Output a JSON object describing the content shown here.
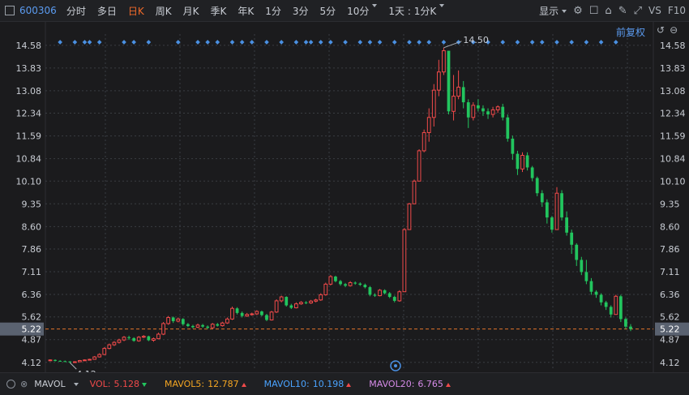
{
  "toolbar": {
    "code": "600306",
    "tabs": [
      {
        "label": "分时",
        "active": false,
        "dropdown": false
      },
      {
        "label": "多日",
        "active": false,
        "dropdown": false
      },
      {
        "label": "日K",
        "active": true,
        "dropdown": false
      },
      {
        "label": "周K",
        "active": false,
        "dropdown": false
      },
      {
        "label": "月K",
        "active": false,
        "dropdown": false
      },
      {
        "label": "季K",
        "active": false,
        "dropdown": false
      },
      {
        "label": "年K",
        "active": false,
        "dropdown": false
      },
      {
        "label": "1分",
        "active": false,
        "dropdown": false
      },
      {
        "label": "3分",
        "active": false,
        "dropdown": false
      },
      {
        "label": "5分",
        "active": false,
        "dropdown": false
      },
      {
        "label": "10分",
        "active": false,
        "dropdown": true
      },
      {
        "label": "1天 : 1分K",
        "active": false,
        "dropdown": true
      }
    ],
    "display_label": "显示",
    "vs_label": "VS",
    "f10_label": "F10",
    "icons": [
      "gear-icon",
      "square-icon",
      "camera-icon",
      "pen-icon",
      "expand-icon"
    ]
  },
  "fuquan": {
    "label": "前复权"
  },
  "axis": {
    "ticks": [
      "14.58",
      "13.83",
      "13.08",
      "12.34",
      "11.59",
      "10.84",
      "10.10",
      "9.35",
      "8.60",
      "7.86",
      "7.11",
      "6.36",
      "5.62",
      "4.87",
      "4.12"
    ],
    "current_price": "5.22"
  },
  "annotations": {
    "high": "14.50",
    "low": "4.12"
  },
  "bottom": {
    "indicator": "MAVOL",
    "vol": {
      "label": "VOL:",
      "value": "5.128",
      "dir": "down"
    },
    "mavol5": {
      "label": "MAVOL5:",
      "value": "12.787",
      "dir": "up"
    },
    "mavol10": {
      "label": "MAVOL10:",
      "value": "10.198",
      "dir": "up"
    },
    "mavol20": {
      "label": "MAVOL20:",
      "value": "6.765",
      "dir": "up"
    }
  },
  "chart_data": {
    "type": "candlestick",
    "y_range": [
      3.9,
      14.95
    ],
    "colors": {
      "up": "#f04a4a",
      "down": "#22c55e",
      "grid": "#3a3d42",
      "label": "#c9cdd4",
      "marker": "#4a90e2",
      "mavol5": "#f5a623",
      "mavol10": "#4aa3ff",
      "mavol20": "#d68be8"
    },
    "candles": [
      [
        4.18,
        4.2,
        4.22,
        4.16
      ],
      [
        4.2,
        4.17,
        4.22,
        4.15
      ],
      [
        4.17,
        4.16,
        4.19,
        4.14
      ],
      [
        4.16,
        4.15,
        4.18,
        4.13
      ],
      [
        4.15,
        4.12,
        4.16,
        4.11
      ],
      [
        4.12,
        4.14,
        4.16,
        4.11
      ],
      [
        4.14,
        4.18,
        4.2,
        4.13
      ],
      [
        4.18,
        4.2,
        4.22,
        4.17
      ],
      [
        4.2,
        4.22,
        4.24,
        4.19
      ],
      [
        4.22,
        4.3,
        4.33,
        4.21
      ],
      [
        4.3,
        4.38,
        4.42,
        4.28
      ],
      [
        4.38,
        4.58,
        4.62,
        4.36
      ],
      [
        4.58,
        4.7,
        4.74,
        4.55
      ],
      [
        4.7,
        4.78,
        4.82,
        4.66
      ],
      [
        4.78,
        4.86,
        4.9,
        4.74
      ],
      [
        4.86,
        4.95,
        4.99,
        4.82
      ],
      [
        4.95,
        4.92,
        5.0,
        4.86
      ],
      [
        4.92,
        4.83,
        4.95,
        4.8
      ],
      [
        4.83,
        4.95,
        4.99,
        4.8
      ],
      [
        4.95,
        4.98,
        5.02,
        4.92
      ],
      [
        4.98,
        4.85,
        5.0,
        4.82
      ],
      [
        4.85,
        4.9,
        4.94,
        4.8
      ],
      [
        4.9,
        5.05,
        5.1,
        4.88
      ],
      [
        5.05,
        5.4,
        5.45,
        5.02
      ],
      [
        5.4,
        5.6,
        5.65,
        5.36
      ],
      [
        5.6,
        5.48,
        5.63,
        5.42
      ],
      [
        5.48,
        5.55,
        5.6,
        5.44
      ],
      [
        5.55,
        5.38,
        5.58,
        5.33
      ],
      [
        5.38,
        5.32,
        5.42,
        5.28
      ],
      [
        5.32,
        5.28,
        5.36,
        5.24
      ],
      [
        5.28,
        5.35,
        5.4,
        5.25
      ],
      [
        5.35,
        5.3,
        5.39,
        5.26
      ],
      [
        5.3,
        5.26,
        5.34,
        5.22
      ],
      [
        5.26,
        5.38,
        5.42,
        5.24
      ],
      [
        5.38,
        5.33,
        5.42,
        5.3
      ],
      [
        5.33,
        5.42,
        5.46,
        5.3
      ],
      [
        5.42,
        5.55,
        5.6,
        5.39
      ],
      [
        5.55,
        5.9,
        5.96,
        5.52
      ],
      [
        5.9,
        5.75,
        5.94,
        5.7
      ],
      [
        5.75,
        5.65,
        5.8,
        5.6
      ],
      [
        5.65,
        5.7,
        5.75,
        5.62
      ],
      [
        5.7,
        5.72,
        5.76,
        5.66
      ],
      [
        5.72,
        5.8,
        5.84,
        5.68
      ],
      [
        5.8,
        5.68,
        5.83,
        5.64
      ],
      [
        5.68,
        5.52,
        5.72,
        5.48
      ],
      [
        5.52,
        5.78,
        5.82,
        5.5
      ],
      [
        5.78,
        6.15,
        6.2,
        5.75
      ],
      [
        6.15,
        6.28,
        6.32,
        6.1
      ],
      [
        6.28,
        6.0,
        6.3,
        5.96
      ],
      [
        6.0,
        5.92,
        6.05,
        5.88
      ],
      [
        5.92,
        6.05,
        6.1,
        5.9
      ],
      [
        6.05,
        6.1,
        6.14,
        6.02
      ],
      [
        6.1,
        6.08,
        6.14,
        6.04
      ],
      [
        6.08,
        6.14,
        6.18,
        6.05
      ],
      [
        6.14,
        6.18,
        6.22,
        6.1
      ],
      [
        6.18,
        6.35,
        6.4,
        6.15
      ],
      [
        6.35,
        6.7,
        6.75,
        6.32
      ],
      [
        6.7,
        6.95,
        7.0,
        6.66
      ],
      [
        6.95,
        6.8,
        6.98,
        6.76
      ],
      [
        6.8,
        6.7,
        6.84,
        6.65
      ],
      [
        6.7,
        6.65,
        6.74,
        6.6
      ],
      [
        6.65,
        6.75,
        6.8,
        6.62
      ],
      [
        6.75,
        6.72,
        6.79,
        6.68
      ],
      [
        6.72,
        6.68,
        6.76,
        6.64
      ],
      [
        6.68,
        6.6,
        6.72,
        6.56
      ],
      [
        6.6,
        6.35,
        6.64,
        6.3
      ],
      [
        6.35,
        6.32,
        6.4,
        6.28
      ],
      [
        6.32,
        6.5,
        6.54,
        6.3
      ],
      [
        6.5,
        6.4,
        6.53,
        6.36
      ],
      [
        6.4,
        6.28,
        6.44,
        6.24
      ],
      [
        6.28,
        6.15,
        6.32,
        6.1
      ],
      [
        6.15,
        6.45,
        6.5,
        6.12
      ],
      [
        6.45,
        8.5,
        8.55,
        6.45
      ],
      [
        8.5,
        9.35,
        9.38,
        8.5
      ],
      [
        9.35,
        10.1,
        10.15,
        9.35
      ],
      [
        10.1,
        11.1,
        11.15,
        10.1
      ],
      [
        11.1,
        11.7,
        11.8,
        11.05
      ],
      [
        11.7,
        12.2,
        12.5,
        11.4
      ],
      [
        12.2,
        13.1,
        13.3,
        11.9
      ],
      [
        13.1,
        13.7,
        14.1,
        12.9
      ],
      [
        13.7,
        14.4,
        14.5,
        13.6
      ],
      [
        14.4,
        12.4,
        14.3,
        12.3
      ],
      [
        12.4,
        12.9,
        13.6,
        12.1
      ],
      [
        12.9,
        13.2,
        13.75,
        12.8
      ],
      [
        13.2,
        12.7,
        13.4,
        12.5
      ],
      [
        12.7,
        12.2,
        12.8,
        11.85
      ],
      [
        12.2,
        12.6,
        12.7,
        12.1
      ],
      [
        12.6,
        12.5,
        12.8,
        12.4
      ],
      [
        12.5,
        12.4,
        12.6,
        12.25
      ],
      [
        12.4,
        12.3,
        12.5,
        12.15
      ],
      [
        12.3,
        12.45,
        12.55,
        12.2
      ],
      [
        12.45,
        12.55,
        12.6,
        12.35
      ],
      [
        12.55,
        12.2,
        12.65,
        12.1
      ],
      [
        12.2,
        11.5,
        12.3,
        11.4
      ],
      [
        11.5,
        11.0,
        11.6,
        10.8
      ],
      [
        11.0,
        10.5,
        11.1,
        10.3
      ],
      [
        10.5,
        10.95,
        11.05,
        10.4
      ],
      [
        10.95,
        10.55,
        11.05,
        10.45
      ],
      [
        10.55,
        10.2,
        10.6,
        10.1
      ],
      [
        10.2,
        9.7,
        10.25,
        9.6
      ],
      [
        9.7,
        9.4,
        9.8,
        9.25
      ],
      [
        9.4,
        8.9,
        9.5,
        8.7
      ],
      [
        8.9,
        8.5,
        8.95,
        8.4
      ],
      [
        8.5,
        9.7,
        9.9,
        8.5
      ],
      [
        9.7,
        8.9,
        9.8,
        8.8
      ],
      [
        8.9,
        8.4,
        9.1,
        8.3
      ],
      [
        8.4,
        8.0,
        8.5,
        7.7
      ],
      [
        8.0,
        7.5,
        8.05,
        7.3
      ],
      [
        7.5,
        7.1,
        7.6,
        7.0
      ],
      [
        7.1,
        6.8,
        7.5,
        6.7
      ],
      [
        6.8,
        6.45,
        6.9,
        6.35
      ],
      [
        6.45,
        6.35,
        6.5,
        6.25
      ],
      [
        6.35,
        6.1,
        6.4,
        6.0
      ],
      [
        6.1,
        5.95,
        6.15,
        5.85
      ],
      [
        5.95,
        5.7,
        6.0,
        5.6
      ],
      [
        5.7,
        6.3,
        6.35,
        5.7
      ],
      [
        6.3,
        5.55,
        6.35,
        5.45
      ],
      [
        5.55,
        5.3,
        5.6,
        5.22
      ],
      [
        5.3,
        5.22,
        5.38,
        5.15
      ]
    ],
    "markers": [
      2,
      5,
      7,
      8,
      10,
      15,
      17,
      20,
      26,
      30,
      32,
      34,
      37,
      39,
      41,
      44,
      47,
      50,
      52,
      53,
      55,
      57,
      60,
      63,
      65,
      67,
      70,
      73,
      75,
      77,
      80,
      83,
      86,
      89,
      92,
      95,
      98,
      100,
      103,
      106,
      109,
      112,
      115
    ]
  }
}
